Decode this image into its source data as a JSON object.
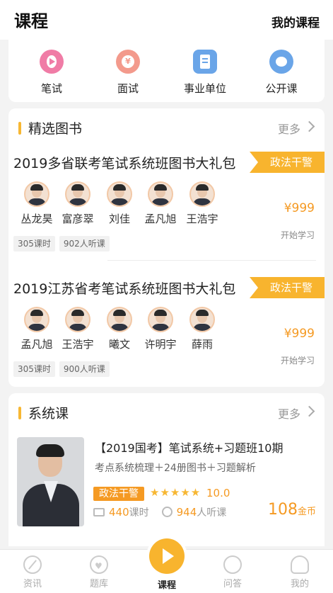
{
  "header": {
    "title": "课程",
    "my_courses": "我的课程"
  },
  "categories": [
    {
      "label": "笔试",
      "icon": "play-circle-icon",
      "color": "#f07ca6"
    },
    {
      "label": "面试",
      "icon": "yen-circle-icon",
      "color": "#f39a8c"
    },
    {
      "label": "事业单位",
      "icon": "building-icon",
      "color": "#6aa5e8"
    },
    {
      "label": "公开课",
      "icon": "bubble-icon",
      "color": "#6aa5e8"
    }
  ],
  "books": {
    "title": "精选图书",
    "more": "更多",
    "packages": [
      {
        "title": "2019多省联考笔试系统班图书大礼包",
        "tag": "政法干警",
        "teachers": [
          "丛龙昊",
          "富彦翠",
          "刘佳",
          "孟凡旭",
          "王浩宇"
        ],
        "hours": "305课时",
        "listeners": "902人听课",
        "price": "¥999",
        "action": "开始学习"
      },
      {
        "title": "2019江苏省考笔试系统班图书大礼包",
        "tag": "政法干警",
        "teachers": [
          "孟凡旭",
          "王浩宇",
          "曦文",
          "许明宇",
          "薛雨"
        ],
        "hours": "305课时",
        "listeners": "900人听课",
        "price": "¥999",
        "action": "开始学习"
      }
    ]
  },
  "system": {
    "title": "系统课",
    "more": "更多",
    "course": {
      "title": "【2019国考】笔试系统+习题班10期",
      "subtitle": "考点系统梳理＋24册图书＋习题解析",
      "tag": "政法干警",
      "stars": "★★★★★",
      "rating": "10.0",
      "hours_num": "440",
      "hours_unit": "课时",
      "listeners_num": "944",
      "listeners_unit": "人听课",
      "price_num": "108",
      "price_unit": "金币"
    }
  },
  "tabs": [
    {
      "label": "资讯",
      "icon": "compass-icon"
    },
    {
      "label": "题库",
      "icon": "heart-icon"
    },
    {
      "label": "课程",
      "icon": "play-icon",
      "active": true
    },
    {
      "label": "问答",
      "icon": "chat-icon"
    },
    {
      "label": "我的",
      "icon": "user-icon"
    }
  ]
}
